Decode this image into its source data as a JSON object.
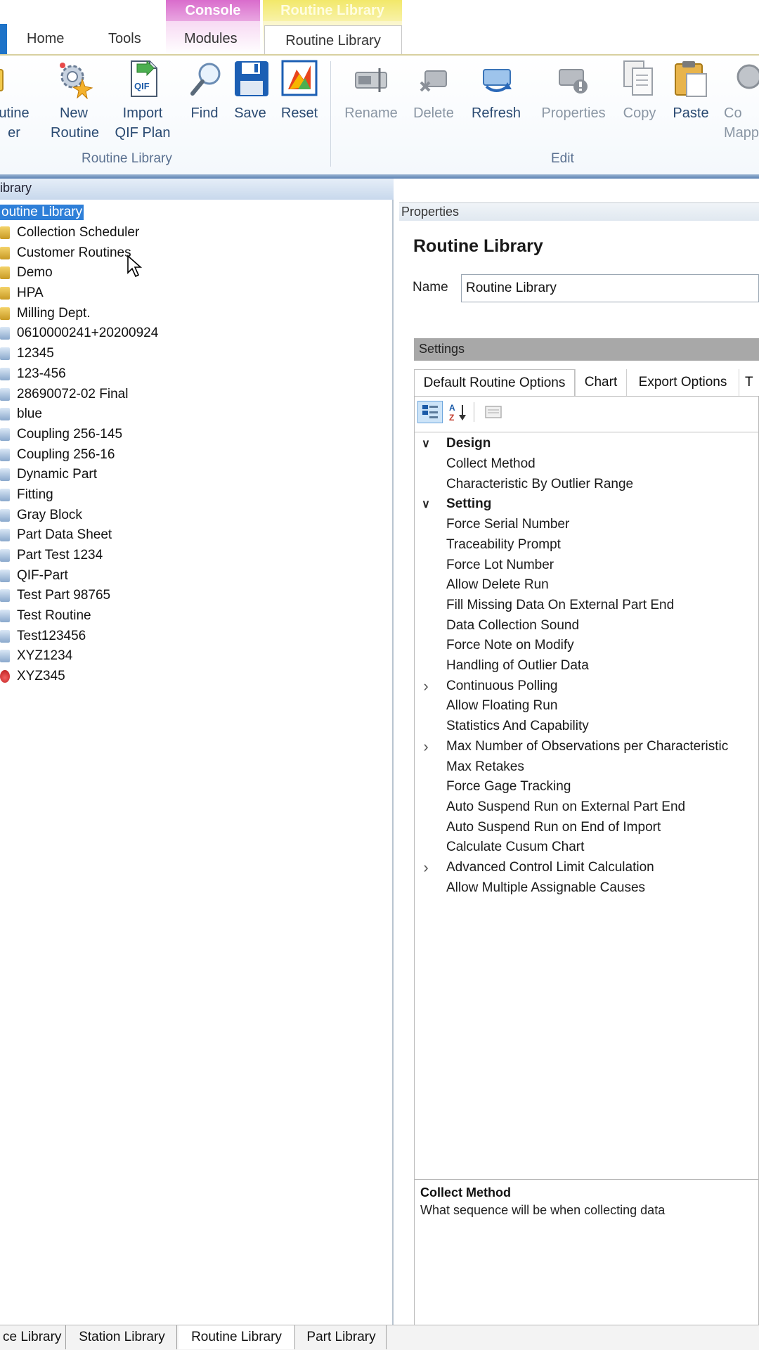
{
  "ribbon": {
    "context_headers": {
      "console": "Console",
      "routine_library": "Routine Library"
    },
    "tabs": {
      "home": "Home",
      "tools": "Tools",
      "modules": "Modules",
      "routine_library": "Routine Library"
    },
    "buttons": {
      "routine_folder": "utine\ner",
      "new_routine": "New\nRoutine",
      "import_qif": "Import\nQIF Plan",
      "find": "Find",
      "save": "Save",
      "reset": "Reset",
      "rename": "Rename",
      "delete": "Delete",
      "refresh": "Refresh",
      "properties": "Properties",
      "copy": "Copy",
      "paste": "Paste",
      "copy_mapping": "Co\nMapp"
    },
    "groups": {
      "routine_library": "Routine Library",
      "edit": "Edit"
    },
    "qif_icon_text": "QIF"
  },
  "left_panel": {
    "title": "ibrary",
    "tree": [
      {
        "label": "outine Library",
        "kind": "root",
        "selected": true
      },
      {
        "label": "Collection Scheduler",
        "kind": "folder"
      },
      {
        "label": "Customer Routines",
        "kind": "folder"
      },
      {
        "label": "Demo",
        "kind": "folder"
      },
      {
        "label": "HPA",
        "kind": "folder"
      },
      {
        "label": "Milling Dept.",
        "kind": "folder"
      },
      {
        "label": "0610000241+20200924",
        "kind": "routine"
      },
      {
        "label": "12345",
        "kind": "routine"
      },
      {
        "label": "123-456",
        "kind": "routine"
      },
      {
        "label": "28690072-02 Final",
        "kind": "routine"
      },
      {
        "label": "blue",
        "kind": "routine"
      },
      {
        "label": "Coupling 256-145",
        "kind": "routine"
      },
      {
        "label": "Coupling 256-16",
        "kind": "routine"
      },
      {
        "label": "Dynamic Part",
        "kind": "routine"
      },
      {
        "label": "Fitting",
        "kind": "routine"
      },
      {
        "label": "Gray Block",
        "kind": "routine"
      },
      {
        "label": "Part Data Sheet",
        "kind": "routine"
      },
      {
        "label": "Part Test 1234",
        "kind": "routine"
      },
      {
        "label": "QIF-Part",
        "kind": "routine"
      },
      {
        "label": "Test Part 98765",
        "kind": "routine"
      },
      {
        "label": "Test Routine",
        "kind": "routine"
      },
      {
        "label": "Test123456",
        "kind": "routine"
      },
      {
        "label": "XYZ1234",
        "kind": "routine"
      },
      {
        "label": "XYZ345",
        "kind": "locked"
      }
    ]
  },
  "properties": {
    "title": "Properties",
    "heading": "Routine Library",
    "name_label": "Name",
    "name_value": "Routine Library",
    "settings_label": "Settings",
    "tabs": [
      "Default Routine Options",
      "Chart",
      "Export Options",
      "T"
    ],
    "grid": [
      {
        "label": "Design",
        "type": "category",
        "expander": "expanded"
      },
      {
        "label": "Collect Method",
        "type": "item",
        "expander": ""
      },
      {
        "label": "Characteristic By Outlier Range",
        "type": "item",
        "expander": ""
      },
      {
        "label": "Setting",
        "type": "category",
        "expander": "expanded"
      },
      {
        "label": "Force Serial Number",
        "type": "item",
        "expander": ""
      },
      {
        "label": "Traceability Prompt",
        "type": "item",
        "expander": ""
      },
      {
        "label": "Force Lot Number",
        "type": "item",
        "expander": ""
      },
      {
        "label": "Allow Delete Run",
        "type": "item",
        "expander": ""
      },
      {
        "label": "Fill Missing Data On External Part End",
        "type": "item",
        "expander": ""
      },
      {
        "label": "Data Collection Sound",
        "type": "item",
        "expander": ""
      },
      {
        "label": "Force Note on Modify",
        "type": "item",
        "expander": ""
      },
      {
        "label": "Handling of Outlier Data",
        "type": "item",
        "expander": ""
      },
      {
        "label": "Continuous Polling",
        "type": "item",
        "expander": "collapsed"
      },
      {
        "label": "Allow Floating Run",
        "type": "item",
        "expander": ""
      },
      {
        "label": "Statistics And Capability",
        "type": "item",
        "expander": ""
      },
      {
        "label": "Max Number of Observations per Characteristic",
        "type": "item",
        "expander": "collapsed"
      },
      {
        "label": "Max Retakes",
        "type": "item",
        "expander": ""
      },
      {
        "label": "Force Gage Tracking",
        "type": "item",
        "expander": ""
      },
      {
        "label": "Auto Suspend Run on External Part End",
        "type": "item",
        "expander": ""
      },
      {
        "label": "Auto Suspend Run on End of Import",
        "type": "item",
        "expander": ""
      },
      {
        "label": "Calculate Cusum Chart",
        "type": "item",
        "expander": ""
      },
      {
        "label": "Advanced Control Limit Calculation",
        "type": "item",
        "expander": "collapsed"
      },
      {
        "label": "Allow Multiple Assignable Causes",
        "type": "item",
        "expander": ""
      }
    ],
    "description": {
      "title": "Collect Method",
      "text": "What sequence will be when collecting data"
    }
  },
  "bottom_tabs": [
    {
      "label": "ce Library",
      "active": false
    },
    {
      "label": "Station Library",
      "active": false
    },
    {
      "label": "Routine Library",
      "active": true
    },
    {
      "label": "Part Library",
      "active": false
    }
  ],
  "colors": {
    "selection": "#2e7fd8",
    "ribbon_text": "#2a4a72",
    "console_accent": "#d96ccc",
    "routine_accent": "#f2e86a"
  }
}
